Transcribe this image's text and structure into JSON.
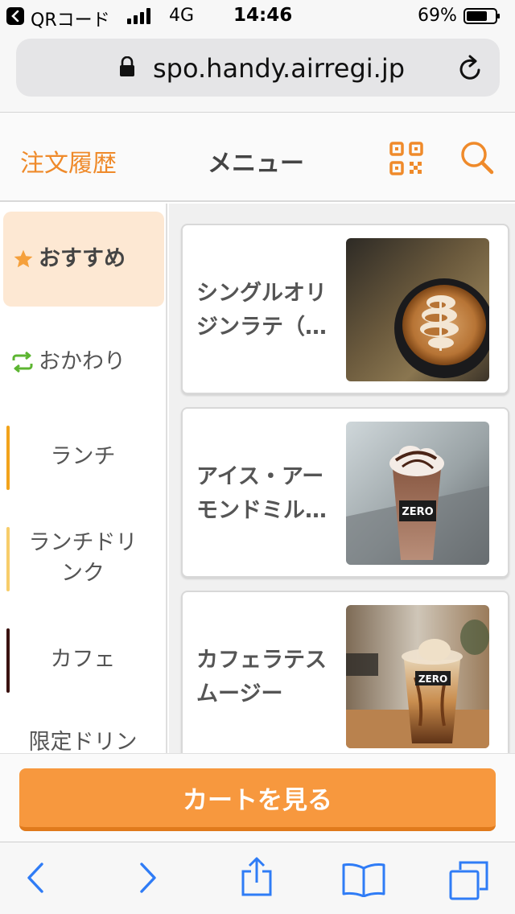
{
  "status_bar": {
    "back_app": "QRコード",
    "network": "4G",
    "time": "14:46",
    "battery": "69%"
  },
  "browser": {
    "url": "spo.handy.airregi.jp"
  },
  "header": {
    "history_label": "注文履歴",
    "title": "メニュー"
  },
  "sidebar": {
    "categories": [
      {
        "label": "おすすめ",
        "icon": "star-icon",
        "color": "#f5a03c"
      },
      {
        "label": "おかわり",
        "icon": "refresh-icon",
        "color": "#5cb531"
      },
      {
        "label": "ランチ",
        "bar_color": "#f2a31b"
      },
      {
        "label": "ランチドリンク",
        "bar_color": "#f7cd6a"
      },
      {
        "label": "カフェ",
        "bar_color": "#3a1210"
      },
      {
        "label": "限定ドリン"
      }
    ]
  },
  "menu": {
    "items": [
      {
        "name": "シングルオリジンラテ（…",
        "image": "latte-art-photo"
      },
      {
        "name": "アイス・アーモンドミル…",
        "image": "iced-chocolate-drink-photo"
      },
      {
        "name": "カフェラテスムージー",
        "image": "cafe-latte-smoothie-photo"
      }
    ]
  },
  "cart": {
    "button_label": "カートを見る"
  },
  "colors": {
    "accent": "#ef8a2a",
    "cart_button": "#f7983e",
    "active_category_bg": "#fde8d3",
    "toolbar_icon": "#2f7cf6"
  }
}
